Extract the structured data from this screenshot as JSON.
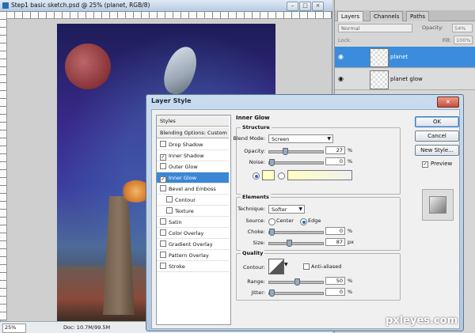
{
  "document": {
    "title": "Step1 basic sketch.psd @ 25% (planet, RGB/8)",
    "zoom": "25%",
    "doc_size": "Doc: 10.7M/99.5M"
  },
  "layers_panel": {
    "tabs": [
      "Layers",
      "Channels",
      "Paths"
    ],
    "blend_mode": "Normal",
    "opacity_label": "Opacity:",
    "opacity_value": "54%",
    "lock_label": "Lock:",
    "fill_label": "Fill:",
    "fill_value": "100%",
    "layers": [
      {
        "name": "planet",
        "selected": true
      },
      {
        "name": "planet glow",
        "selected": false
      }
    ]
  },
  "layer_style": {
    "title": "Layer Style",
    "styles_header": "Styles",
    "blending_options": "Blending Options: Custom",
    "style_items": [
      {
        "label": "Drop Shadow",
        "checked": false
      },
      {
        "label": "Inner Shadow",
        "checked": true
      },
      {
        "label": "Outer Glow",
        "checked": false
      },
      {
        "label": "Inner Glow",
        "checked": true,
        "selected": true
      },
      {
        "label": "Bevel and Emboss",
        "checked": false
      },
      {
        "label": "Contour",
        "checked": false,
        "indent": true
      },
      {
        "label": "Texture",
        "checked": false,
        "indent": true
      },
      {
        "label": "Satin",
        "checked": false
      },
      {
        "label": "Color Overlay",
        "checked": false
      },
      {
        "label": "Gradient Overlay",
        "checked": false
      },
      {
        "label": "Pattern Overlay",
        "checked": false
      },
      {
        "label": "Stroke",
        "checked": false
      }
    ],
    "section_title": "Inner Glow",
    "structure": {
      "legend": "Structure",
      "blend_mode_label": "Blend Mode:",
      "blend_mode": "Screen",
      "opacity_label": "Opacity:",
      "opacity": "27",
      "opacity_level": 27,
      "noise_label": "Noise:",
      "noise": "0",
      "noise_level": 0,
      "percent": "%",
      "glow_color": "#ffffc4"
    },
    "elements": {
      "legend": "Elements",
      "technique_label": "Technique:",
      "technique": "Softer",
      "source_label": "Source:",
      "source_center": "Center",
      "source_edge": "Edge",
      "choke_label": "Choke:",
      "choke": "0",
      "choke_level": 0,
      "size_label": "Size:",
      "size": "87",
      "size_level": 35,
      "percent": "%",
      "px": "px"
    },
    "quality": {
      "legend": "Quality",
      "contour_label": "Contour:",
      "anti_aliased": "Anti-aliased",
      "range_label": "Range:",
      "range": "50",
      "range_level": 50,
      "jitter_label": "Jitter:",
      "jitter": "0",
      "jitter_level": 0,
      "percent": "%"
    },
    "buttons": {
      "ok": "OK",
      "cancel": "Cancel",
      "new_style": "New Style...",
      "preview": "Preview"
    }
  },
  "watermark": "pxleyes.com"
}
